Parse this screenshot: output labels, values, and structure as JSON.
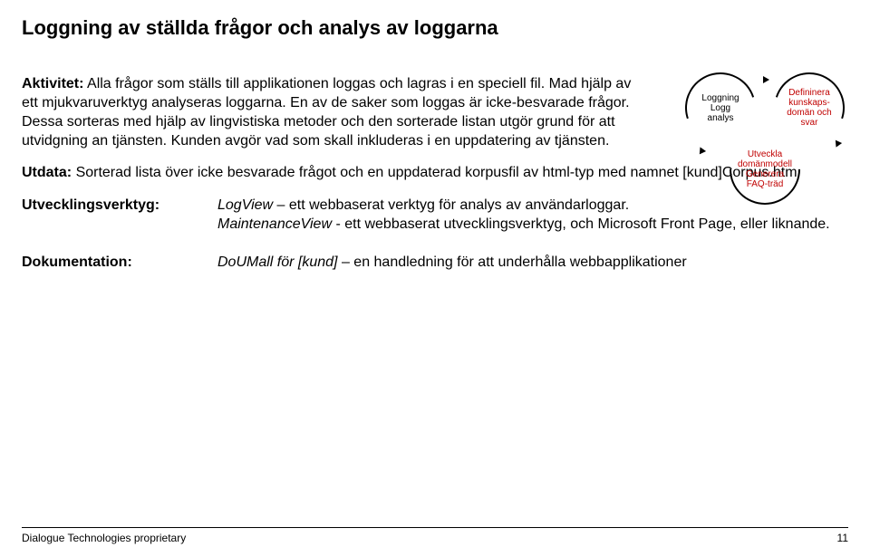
{
  "title": "Loggning av ställda frågor och analys av loggarna",
  "aktivitet": {
    "label": "Aktivitet:",
    "text": "Alla frågor som ställs till applikationen loggas och lagras i en speciell fil. Mad hjälp av ett mjukvaruverktyg analyseras loggarna. En av de saker som loggas är icke-besvarade frågor. Dessa sorteras med hjälp av lingvistiska metoder och den sorterade listan utgör grund för att utvidgning an tjänsten. Kunden avgör vad som skall inkluderas i en uppdatering av tjänsten."
  },
  "utdata": {
    "label": "Utdata:",
    "text": "Sorterad lista över icke besvarade frågot och en uppdaterad korpusfil av html-typ med namnet [kund]Corpus.htm"
  },
  "utvecklingsverktyg": {
    "label": "Utvecklingsverktyg:",
    "line1_italic": "LogView",
    "line1_rest": " – ett webbaserat verktyg för analys av användarloggar.",
    "line2_italic": "MaintenanceView",
    "line2_rest": " - ett webbaserat utvecklingsverktyg, och Microsoft Front Page, eller liknande."
  },
  "dokumentation": {
    "label": "Dokumentation:",
    "italic": "DoUMall för [kund]",
    "rest": " – en handledning för att underhålla webbapplikationer"
  },
  "diagram": {
    "top_left": "Loggning\nLogg\nanalys",
    "top_right": "Defininera kunskaps-domän och svar",
    "bottom": "Utveckla domänmodell Generera FAQ-träd"
  },
  "footer": {
    "left": "Dialogue Technologies proprietary",
    "right": "11"
  }
}
